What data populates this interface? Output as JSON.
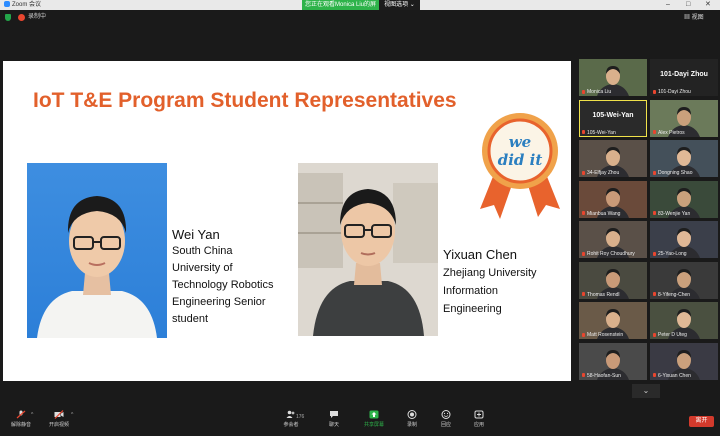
{
  "window": {
    "app_title": "Zoom 会议",
    "minimize": "–",
    "maximize": "□",
    "close": "✕"
  },
  "share_banner": {
    "status": "您正在观看Monica Liu的屏幕",
    "options": "视图选项 ⌄"
  },
  "topbar": {
    "recording_label": "录制中",
    "view_label": "视图"
  },
  "slide": {
    "title": "IoT T&E Program Student Representatives",
    "badge_text": [
      "we",
      "did it"
    ],
    "student1": {
      "name": "Wei Yan",
      "lines": [
        "South China",
        "University of",
        "Technology Robotics",
        "Engineering Senior",
        "student"
      ]
    },
    "student2": {
      "name": "Yixuan Chen",
      "lines": [
        "Zhejiang University",
        "Information",
        "Engineering"
      ]
    }
  },
  "gallery": {
    "tiles": [
      {
        "label": "Monica Liu",
        "big": ""
      },
      {
        "label": "101-Dayi Zhou",
        "big": "101-Dayi Zhou"
      },
      {
        "label": "105-Wei-Yan",
        "big": "105-Wei-Yan"
      },
      {
        "label": "Alex Pietros",
        "big": ""
      },
      {
        "label": "34-Elfjay Zhou",
        "big": ""
      },
      {
        "label": "Dongning Shao",
        "big": ""
      },
      {
        "label": "Mianbua Wang",
        "big": ""
      },
      {
        "label": "83-Wenjie Yan",
        "big": ""
      },
      {
        "label": "Rohit Roy Choudhury",
        "big": ""
      },
      {
        "label": "25-Yao-Long",
        "big": ""
      },
      {
        "label": "Thomas Rendl",
        "big": ""
      },
      {
        "label": "8-Yifeng-Chen",
        "big": ""
      },
      {
        "label": "Matt Rosenstein",
        "big": ""
      },
      {
        "label": "Peter D Uteg",
        "big": ""
      },
      {
        "label": "58-Haofan-Sun",
        "big": ""
      },
      {
        "label": "6-Yixuan Chen",
        "big": ""
      }
    ],
    "more_label": "⌄"
  },
  "toolbar": {
    "unmute": "解除静音",
    "start_video": "开启视频",
    "participants": "参会者",
    "participants_count": "176",
    "chat": "聊天",
    "share": "共享屏幕",
    "record": "录制",
    "reactions": "回应",
    "apps": "应用",
    "leave": "离开"
  },
  "colors": {
    "title_orange": "#e2602b",
    "share_green": "#2eb34a",
    "leave_red": "#d33a2c",
    "active_border": "#f0e24a"
  }
}
